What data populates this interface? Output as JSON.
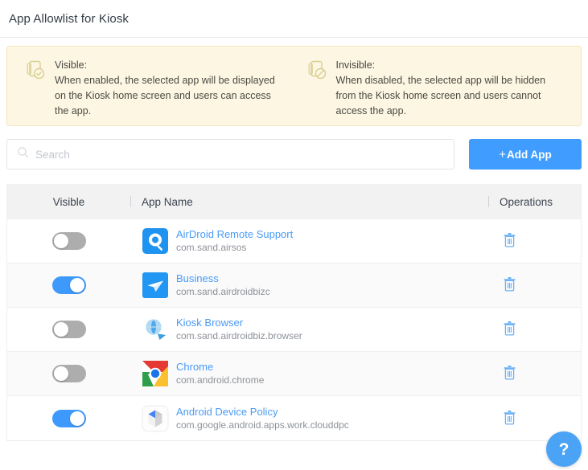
{
  "header": {
    "title": "App Allowlist for Kiosk"
  },
  "notices": [
    {
      "icon": "tablet-check-icon",
      "lead": "Visible:",
      "body": "When enabled, the selected app will be displayed on the Kiosk home screen and users can access the app."
    },
    {
      "icon": "tablet-blocked-icon",
      "lead": "Invisible:",
      "body": "When disabled, the selected app will be hidden from the Kiosk home screen and users cannot access the app."
    }
  ],
  "toolbar": {
    "search_placeholder": "Search",
    "search_value": "",
    "search_icon": "search-icon",
    "add_app_label": "Add App",
    "add_app_plus": "+",
    "accent_color": "#409dff"
  },
  "table": {
    "columns": [
      "Visible",
      "App Name",
      "Operations"
    ],
    "rows": [
      {
        "visible": false,
        "name": "AirDroid Remote Support",
        "package": "com.sand.airsos",
        "icon": "airdroid-remote-support-icon",
        "delete_icon": "trash-icon"
      },
      {
        "visible": true,
        "name": "Business",
        "package": "com.sand.airdroidbizc",
        "icon": "business-icon",
        "delete_icon": "trash-icon"
      },
      {
        "visible": false,
        "name": "Kiosk Browser",
        "package": "com.sand.airdroidbiz.browser",
        "icon": "kiosk-browser-icon",
        "delete_icon": "trash-icon"
      },
      {
        "visible": false,
        "name": "Chrome",
        "package": "com.android.chrome",
        "icon": "chrome-icon",
        "delete_icon": "trash-icon"
      },
      {
        "visible": true,
        "name": "Android Device Policy",
        "package": "com.google.android.apps.work.clouddpc",
        "icon": "android-device-policy-icon",
        "delete_icon": "trash-icon"
      }
    ]
  },
  "help": {
    "label": "?",
    "icon": "help-question-icon"
  }
}
